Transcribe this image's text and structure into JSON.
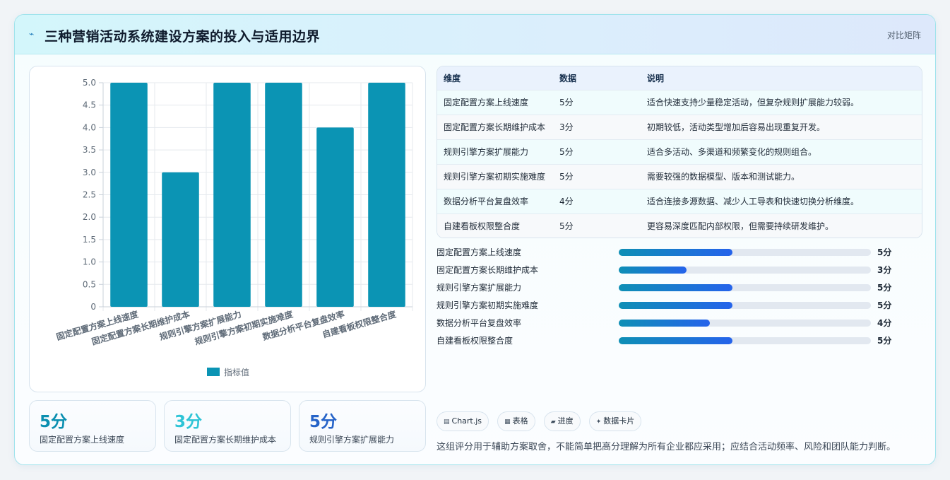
{
  "header": {
    "icon": "pulse-icon",
    "title": "三种营销活动系统建设方案的投入与适用边界",
    "right_label": "对比矩阵"
  },
  "colors": {
    "bar": "#0b94b4",
    "kpi_1": "#0a8fb0",
    "kpi_2": "#2ec4d6",
    "kpi_3": "#2563c8"
  },
  "chart_data": {
    "type": "bar",
    "categories": [
      "固定配置方案上线速度",
      "固定配置方案长期维护成本",
      "规则引擎方案扩展能力",
      "规则引擎方案初期实施难度",
      "数据分析平台复盘效率",
      "自建看板权限整合度"
    ],
    "series": [
      {
        "name": "指标值",
        "values": [
          5,
          3,
          5,
          5,
          4,
          5
        ]
      }
    ],
    "ylim": [
      0,
      5
    ],
    "yticks": [
      "0",
      "0.5",
      "1.0",
      "1.5",
      "2.0",
      "2.5",
      "3.0",
      "3.5",
      "4.0",
      "4.5",
      "5.0"
    ],
    "grid": true,
    "legend": "bottom"
  },
  "kpis": [
    {
      "value": "5分",
      "label": "固定配置方案上线速度"
    },
    {
      "value": "3分",
      "label": "固定配置方案长期维护成本"
    },
    {
      "value": "5分",
      "label": "规则引擎方案扩展能力"
    }
  ],
  "table": {
    "headers": [
      "维度",
      "数据",
      "说明"
    ],
    "rows": [
      [
        "固定配置方案上线速度",
        "5分",
        "适合快速支持少量稳定活动，但复杂规则扩展能力较弱。"
      ],
      [
        "固定配置方案长期维护成本",
        "3分",
        "初期较低，活动类型增加后容易出现重复开发。"
      ],
      [
        "规则引擎方案扩展能力",
        "5分",
        "适合多活动、多渠道和频繁变化的规则组合。"
      ],
      [
        "规则引擎方案初期实施难度",
        "5分",
        "需要较强的数据模型、版本和测试能力。"
      ],
      [
        "数据分析平台复盘效率",
        "4分",
        "适合连接多源数据、减少人工导表和快速切换分析维度。"
      ],
      [
        "自建看板权限整合度",
        "5分",
        "更容易深度匹配内部权限，但需要持续研发维护。"
      ]
    ]
  },
  "progress": [
    {
      "label": "固定配置方案上线速度",
      "value_text": "5分",
      "fraction": 0.45
    },
    {
      "label": "固定配置方案长期维护成本",
      "value_text": "3分",
      "fraction": 0.27
    },
    {
      "label": "规则引擎方案扩展能力",
      "value_text": "5分",
      "fraction": 0.45
    },
    {
      "label": "规则引擎方案初期实施难度",
      "value_text": "5分",
      "fraction": 0.45
    },
    {
      "label": "数据分析平台复盘效率",
      "value_text": "4分",
      "fraction": 0.36
    },
    {
      "label": "自建看板权限整合度",
      "value_text": "5分",
      "fraction": 0.45
    }
  ],
  "pills": [
    {
      "icon": "chart-icon",
      "label": "Chart.js"
    },
    {
      "icon": "table-icon",
      "label": "表格"
    },
    {
      "icon": "progress-icon",
      "label": "进度"
    },
    {
      "icon": "sparkle-icon",
      "label": "数据卡片"
    }
  ],
  "note": "这组评分用于辅助方案取舍，不能简单把高分理解为所有企业都应采用；应结合活动频率、风险和团队能力判断。"
}
